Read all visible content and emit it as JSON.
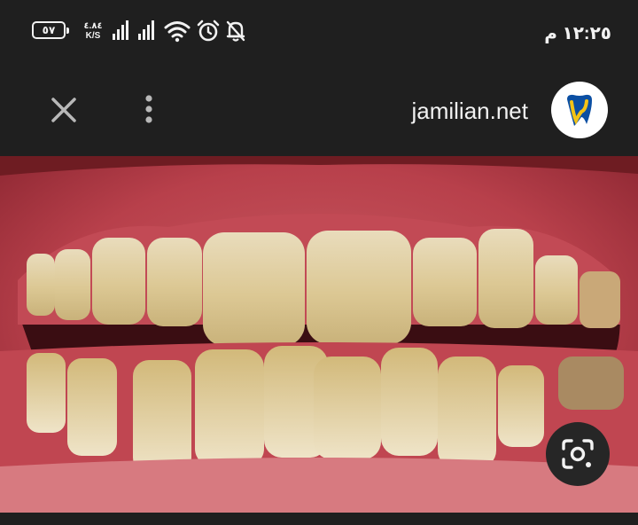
{
  "status_bar": {
    "battery_level": "٥٧",
    "net_speed_value": "٤.٨٤",
    "net_speed_unit": "K/S",
    "time": "١٢:٢٥ م",
    "icons": [
      "signal-icon",
      "signal-icon",
      "wifi-icon",
      "alarm-icon",
      "notifications-off-icon"
    ]
  },
  "toolbar": {
    "close_icon": "close-icon",
    "menu_icon": "more-vert-icon",
    "site_name": "jamilian.net",
    "logo_icon": "tooth-logo-icon"
  },
  "image": {
    "subject": "photo-of-teeth",
    "lens_icon": "google-lens-icon"
  },
  "colors": {
    "background": "#1f1f1f",
    "text": "#f2f2f2",
    "logo_blue": "#0b4fa3",
    "logo_yellow": "#f3c316"
  }
}
